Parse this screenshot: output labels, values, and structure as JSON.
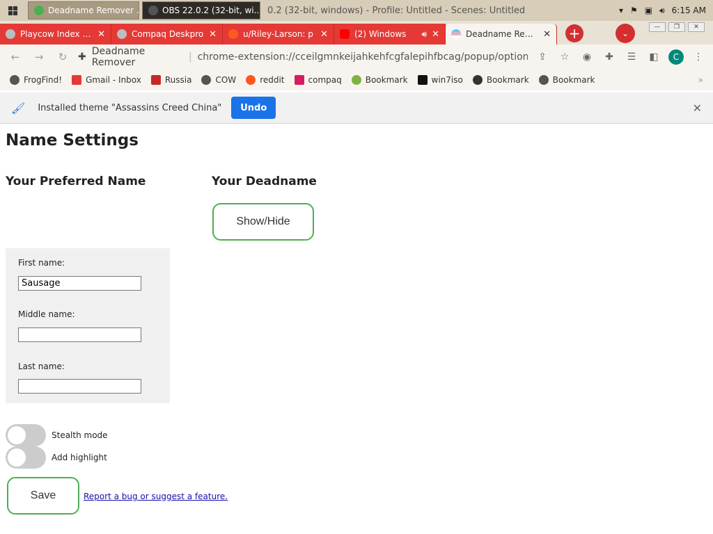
{
  "taskbar": {
    "buttons": [
      "Deadname Remover ...",
      "OBS 22.0.2 (32-bit, wi..."
    ],
    "window_title": "0.2 (32-bit, windows) - Profile: Untitled - Scenes: Untitled",
    "clock": "6:15 AM"
  },
  "tabs": [
    {
      "label": "Playcow Index fro",
      "icon": "globe-icon"
    },
    {
      "label": "Compaq Deskpro",
      "icon": "globe-icon"
    },
    {
      "label": "u/Riley-Larson: p",
      "icon": "reddit-icon"
    },
    {
      "label": "(2) Windows",
      "icon": "youtube-icon"
    },
    {
      "label": "Deadname Remov",
      "icon": "trans-flag-icon",
      "active": true
    }
  ],
  "toolbar": {
    "site_name": "Deadname Remover",
    "url": "chrome-extension://cceilgmnkeijahkehfcgfalepihfbcag/popup/options.html",
    "profile_initial": "C"
  },
  "bookmarks": [
    {
      "label": "FrogFind!",
      "icon": "globe-icon",
      "color": "#555555"
    },
    {
      "label": "Gmail - Inbox",
      "icon": "gmail-icon",
      "color": "#e53935"
    },
    {
      "label": "Russia",
      "icon": "doc-icon",
      "color": "#c62828"
    },
    {
      "label": "COW",
      "icon": "globe-icon",
      "color": "#555555"
    },
    {
      "label": "reddit",
      "icon": "reddit-icon",
      "color": "#ff5722"
    },
    {
      "label": "compaq",
      "icon": "compaq-icon",
      "color": "#d81b60"
    },
    {
      "label": "Bookmark",
      "icon": "game-icon",
      "color": "#7cb342"
    },
    {
      "label": "win7iso",
      "icon": "tw-icon",
      "color": "#111111"
    },
    {
      "label": "Bookmark",
      "icon": "skull-icon",
      "color": "#333333"
    },
    {
      "label": "Bookmark",
      "icon": "globe-icon",
      "color": "#555555"
    }
  ],
  "infobar": {
    "message": "Installed theme \"Assassins Creed China\"",
    "undo_label": "Undo"
  },
  "page": {
    "title": "Name Settings",
    "preferred_heading": "Your Preferred Name",
    "deadname_heading": "Your Deadname",
    "show_hide_label": "Show/Hide",
    "first_name_label": "First name:",
    "first_name_value": "Sausage",
    "middle_name_label": "Middle name:",
    "middle_name_value": "",
    "last_name_label": "Last name:",
    "last_name_value": "",
    "stealth_label": "Stealth mode",
    "stealth_on": false,
    "highlight_label": "Add highlight",
    "highlight_on": false,
    "save_label": "Save",
    "report_link": "Report a bug or suggest a feature."
  },
  "colors": {
    "accent": "#1a73e8",
    "tab_red": "#e53935",
    "button_border_green": "#4caf50"
  }
}
